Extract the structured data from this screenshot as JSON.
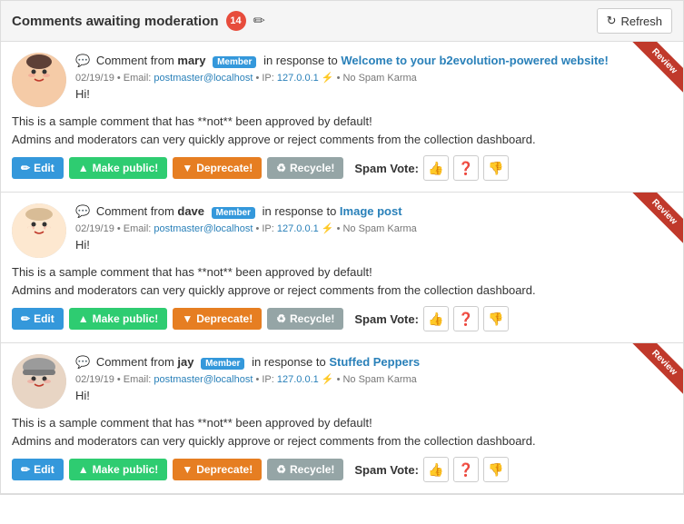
{
  "header": {
    "title": "Comments awaiting moderation",
    "badge_count": "14",
    "refresh_label": "Refresh"
  },
  "comments": [
    {
      "id": 1,
      "user": "mary",
      "badge": "Member",
      "post_link_text": "Welcome to your b2evolution-powered website!",
      "date": "02/19/19",
      "email": "postmaster@localhost",
      "ip": "127.0.0.1",
      "spam_karma": "No Spam Karma",
      "greeting": "Hi!",
      "body_line1": "This is a sample comment that has **not** been approved by default!",
      "body_line2": "Admins and moderators can very quickly approve or reject comments from the collection dashboard.",
      "ribbon": "Review"
    },
    {
      "id": 2,
      "user": "dave",
      "badge": "Member",
      "post_link_text": "Image post",
      "date": "02/19/19",
      "email": "postmaster@localhost",
      "ip": "127.0.0.1",
      "spam_karma": "No Spam Karma",
      "greeting": "Hi!",
      "body_line1": "This is a sample comment that has **not** been approved by default!",
      "body_line2": "Admins and moderators can very quickly approve or reject comments from the collection dashboard.",
      "ribbon": "Review"
    },
    {
      "id": 3,
      "user": "jay",
      "badge": "Member",
      "post_link_text": "Stuffed Peppers",
      "date": "02/19/19",
      "email": "postmaster@localhost",
      "ip": "127.0.0.1",
      "spam_karma": "No Spam Karma",
      "greeting": "Hi!",
      "body_line1": "This is a sample comment that has **not** been approved by default!",
      "body_line2": "Admins and moderators can very quickly approve or reject comments from the collection dashboard.",
      "ribbon": "Review"
    }
  ],
  "buttons": {
    "edit": "Edit",
    "make_public": "Make public!",
    "deprecate": "Deprecate!",
    "recycle": "Recycle!",
    "spam_vote_label": "Spam Vote:"
  }
}
